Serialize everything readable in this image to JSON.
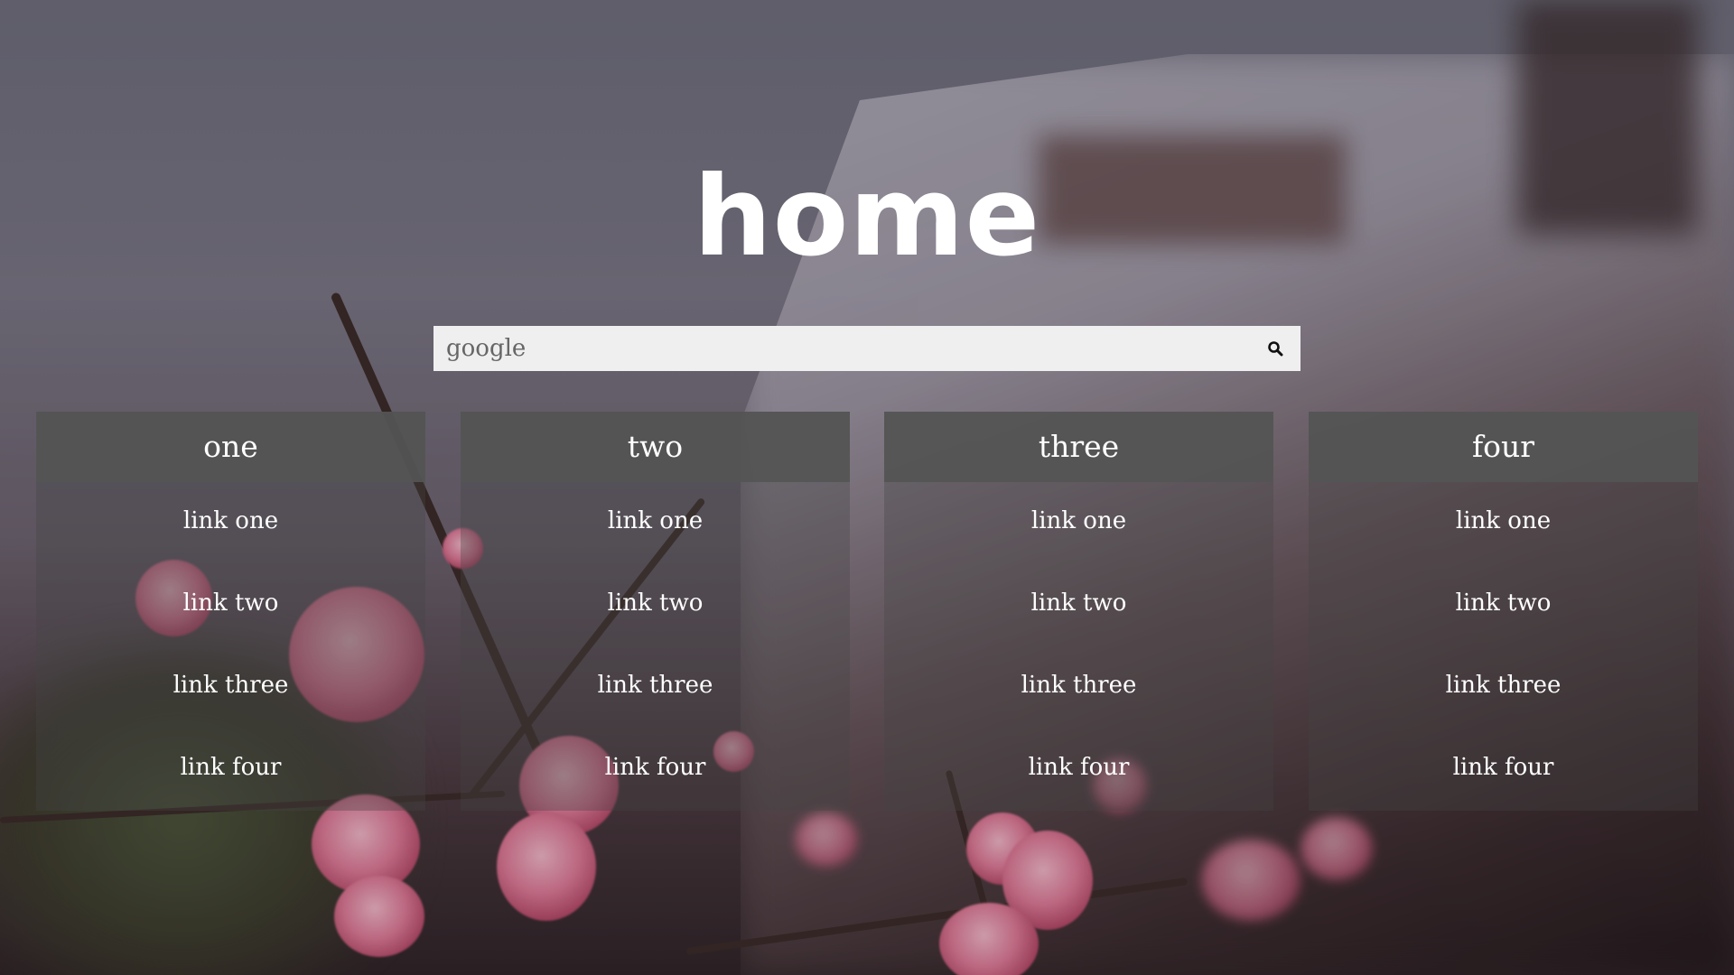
{
  "page": {
    "title": "home"
  },
  "search": {
    "placeholder": "google",
    "value": "",
    "icon": "search-icon"
  },
  "columns": [
    {
      "heading": "one",
      "links": [
        "link one",
        "link two",
        "link three",
        "link four"
      ]
    },
    {
      "heading": "two",
      "links": [
        "link one",
        "link two",
        "link three",
        "link four"
      ]
    },
    {
      "heading": "three",
      "links": [
        "link one",
        "link two",
        "link three",
        "link four"
      ]
    },
    {
      "heading": "four",
      "links": [
        "link one",
        "link two",
        "link three",
        "link four"
      ]
    }
  ],
  "colors": {
    "text": "#ffffff",
    "search_bg": "#efefef",
    "column_header_bg": "#555555",
    "column_body_bg": "#464646"
  }
}
